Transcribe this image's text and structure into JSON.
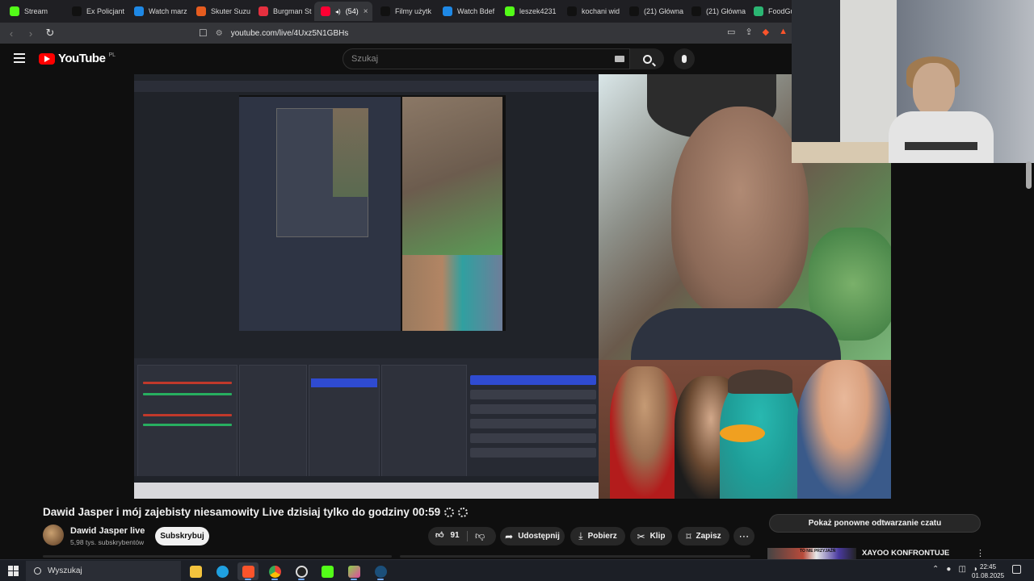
{
  "browser": {
    "tabs": [
      {
        "label": "Stream",
        "favicon": "kick-icon",
        "color": "#53fc18"
      },
      {
        "label": "Ex Policjant",
        "favicon": "tiktok-icon",
        "color": "#111111"
      },
      {
        "label": "Watch marz",
        "favicon": "web-icon",
        "color": "#1e88e5"
      },
      {
        "label": "Skuter Suzu",
        "favicon": "flame-icon",
        "color": "#e65c1f"
      },
      {
        "label": "Burgman St",
        "favicon": "bookmark-icon",
        "color": "#e5303f"
      },
      {
        "label": "(54)",
        "favicon": "youtube-icon",
        "color": "#ff0033",
        "active": true
      },
      {
        "label": "Filmy użytk",
        "favicon": "tiktok-icon",
        "color": "#111111"
      },
      {
        "label": "Watch Bdef",
        "favicon": "web-icon",
        "color": "#1e88e5"
      },
      {
        "label": "leszek4231",
        "favicon": "kick-icon",
        "color": "#53fc18"
      },
      {
        "label": "kochani wid",
        "favicon": "tiktok-icon",
        "color": "#111111"
      },
      {
        "label": "(21) Główna",
        "favicon": "x-icon",
        "color": "#111111"
      },
      {
        "label": "(21) Główna",
        "favicon": "x-icon",
        "color": "#111111"
      },
      {
        "label": "FoodGuess",
        "favicon": "globe-icon",
        "color": "#2bb673"
      }
    ],
    "url": "youtube.com/live/4Uxz5N1GBHs"
  },
  "youtube": {
    "logo_text": "YouTube",
    "region": "PL",
    "search_placeholder": "Szukaj"
  },
  "video": {
    "title": "Dawid Jasper i mój zajebisty niesamowity Live dzisiaj tylko do godziny 00:59",
    "channel_name": "Dawid Jasper live",
    "subscribers": "5,98 tys. subskrybentów",
    "subscribe_label": "Subskrybuj",
    "likes": "91",
    "share_label": "Udostępnij",
    "download_label": "Pobierz",
    "clip_label": "Klip",
    "save_label": "Zapisz"
  },
  "sidebar": {
    "chat_replay_label": "Pokaż ponowne odtwarzanie czatu",
    "recommended": {
      "thumb_text": "TO NIE PRZYJAŹŃ",
      "title": "XAYOO KONFRONTUJE"
    }
  },
  "taskbar": {
    "search_placeholder": "Wyszukaj",
    "time": "22:45",
    "date": "01.08.2025"
  }
}
